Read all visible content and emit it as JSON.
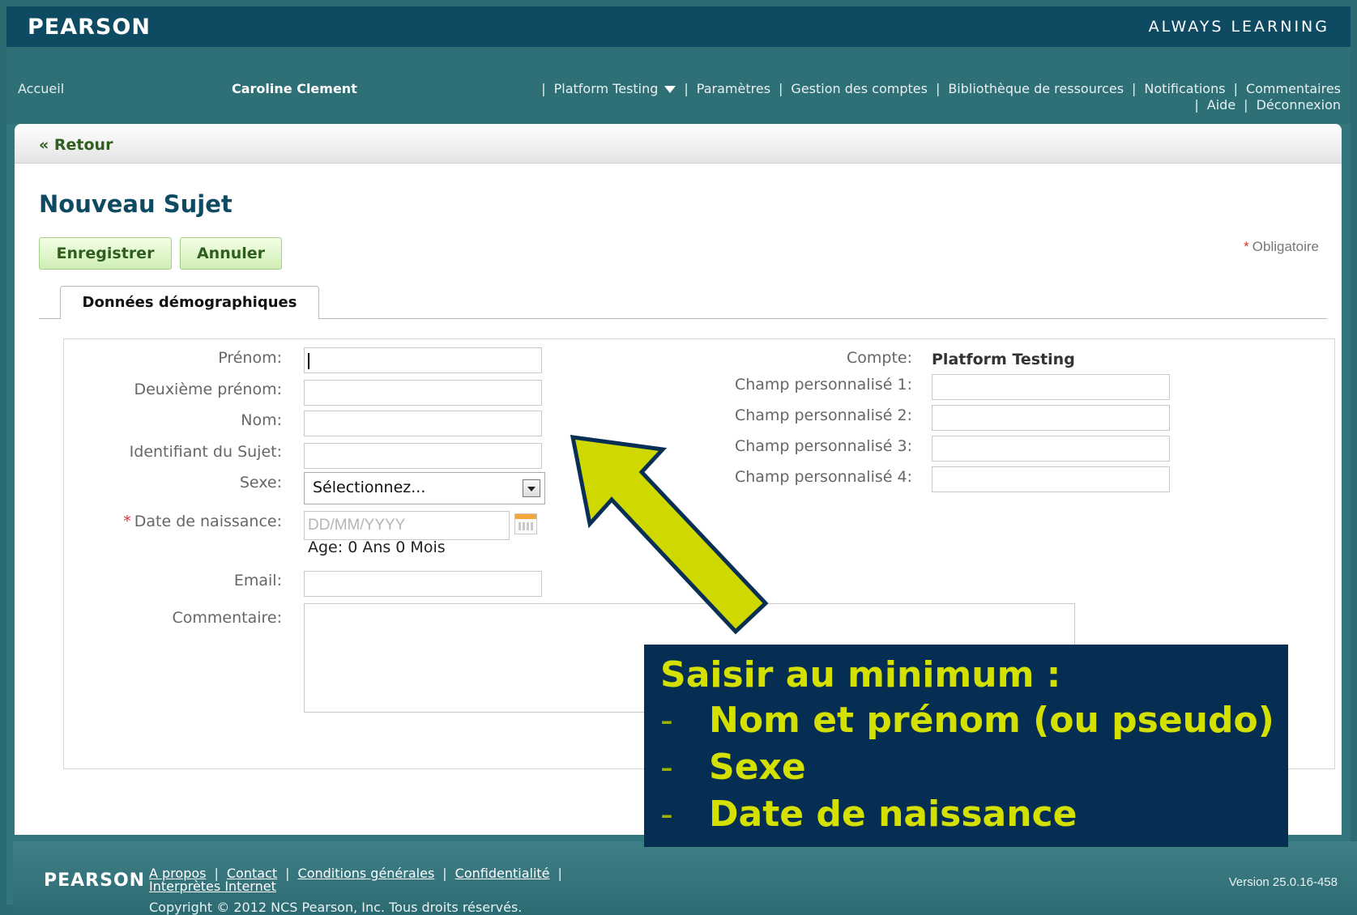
{
  "header": {
    "brand": "PEARSON",
    "tagline": "ALWAYS LEARNING"
  },
  "nav": {
    "home": "Accueil",
    "user": "Caroline Clement",
    "items": [
      "Platform Testing",
      "Paramètres",
      "Gestion des comptes",
      "Bibliothèque de ressources",
      "Notifications",
      "Commentaires",
      "Aide",
      "Déconnexion"
    ],
    "separator": "|"
  },
  "back": {
    "label": "« Retour"
  },
  "page": {
    "title": "Nouveau Sujet"
  },
  "toolbar": {
    "save_label": "Enregistrer",
    "cancel_label": "Annuler",
    "required_note": "Obligatoire",
    "required_mark": "*"
  },
  "tab": {
    "label": "Données démographiques"
  },
  "form": {
    "first_name_label": "Prénom:",
    "middle_name_label": "Deuxième prénom:",
    "last_name_label": "Nom:",
    "subject_id_label": "Identifiant du Sujet:",
    "sex_label": "Sexe:",
    "sex_value": "Sélectionnez...",
    "dob_label": "Date de naissance:",
    "dob_placeholder": "DD/MM/YYYY",
    "age_text": "Age: 0 Ans 0 Mois",
    "email_label": "Email:",
    "comment_label": "Commentaire:",
    "account_label": "Compte:",
    "account_value": "Platform Testing",
    "custom_1_label": "Champ personnalisé 1:",
    "custom_2_label": "Champ personnalisé 2:",
    "custom_3_label": "Champ personnalisé 3:",
    "custom_4_label": "Champ personnalisé 4:"
  },
  "callout": {
    "title": "Saisir au minimum :",
    "items": [
      "Nom et prénom (ou pseudo)",
      "Sexe",
      "Date de naissance"
    ],
    "dash": "-"
  },
  "footer": {
    "brand": "PEARSON",
    "links": [
      "A propos",
      "Contact",
      "Conditions générales",
      "Confidentialité",
      "Interprètes Internet"
    ],
    "copyright": "Copyright © 2012 NCS Pearson, Inc. Tous droits réservés.",
    "version": "Version 25.0.16-458"
  },
  "colors": {
    "header_bg": "#0f4a63",
    "nav_bg": "#2f6f76",
    "accent_green": "#2f5e1f",
    "callout_bg": "#062d52",
    "callout_text": "#d4e000"
  }
}
